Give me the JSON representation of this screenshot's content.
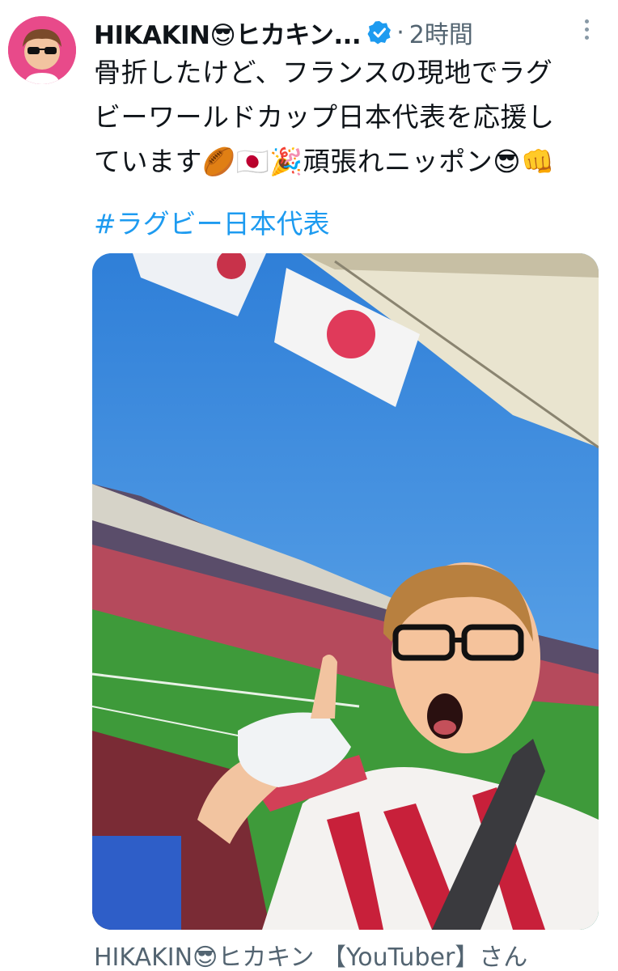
{
  "tweet": {
    "display_name": "HIKAKIN😎ヒカキン...",
    "time_separator": "·",
    "time": "2時間",
    "text_lines": [
      "骨折したけど、フランスの現地でラグ",
      "ビーワールドカップ日本代表を応援し",
      "ています🏉🇯🇵🎉頑張れニッポン😎👊"
    ],
    "hashtag": "#ラグビー日本代表",
    "author_line": "HIKAKIN😎ヒカキン 【YouTuber】さん"
  },
  "icons": {
    "verified": "verified-badge-icon",
    "more": "more-options-icon"
  },
  "colors": {
    "link": "#1d9bf0",
    "secondary_text": "#536471",
    "avatar_bg": "#e84a8a",
    "verified": "#1d9bf0",
    "sky": "#3a8ee0"
  }
}
